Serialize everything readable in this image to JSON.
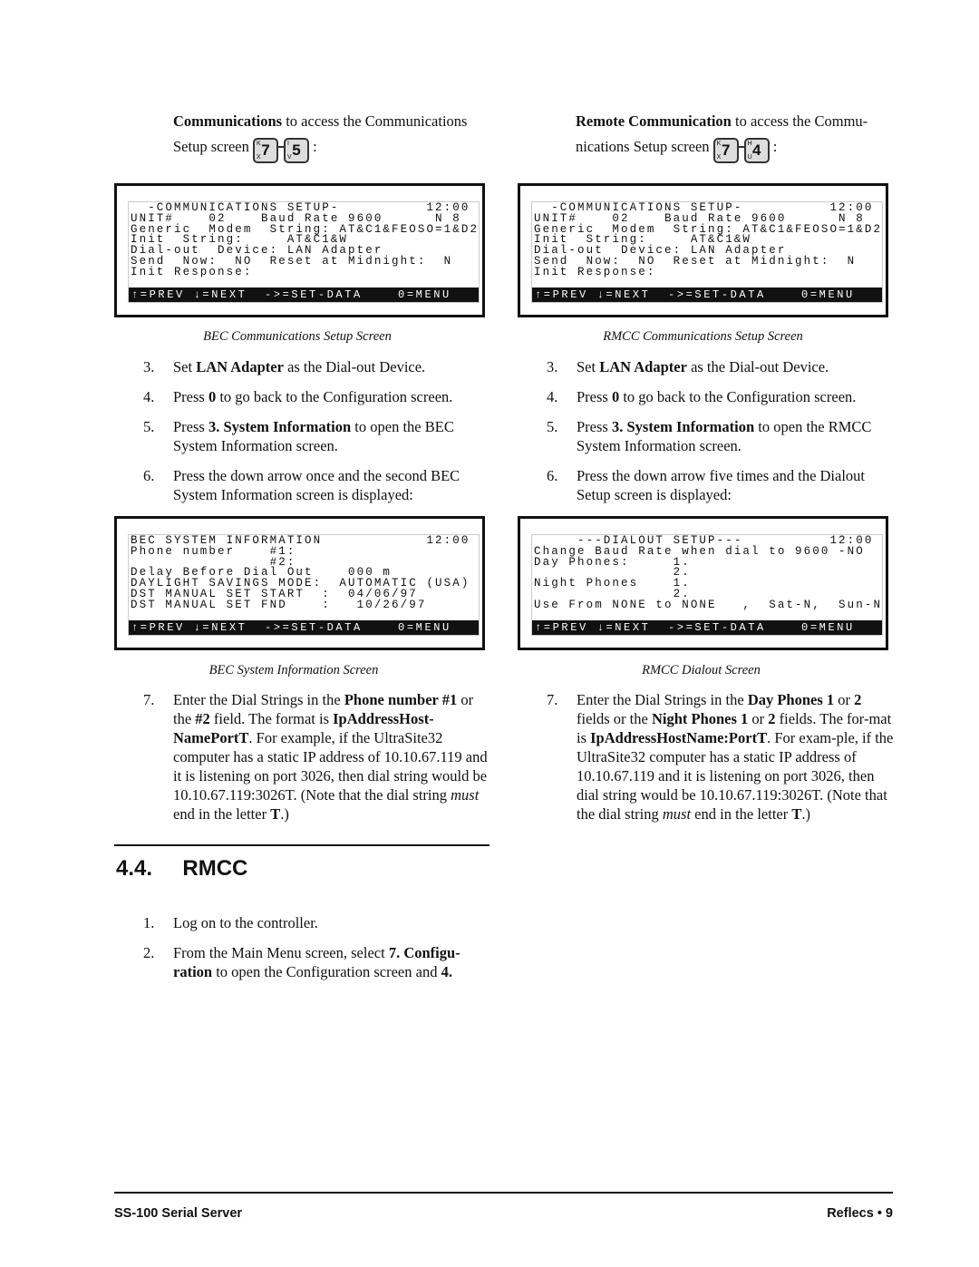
{
  "left": {
    "intro_bold": "Communications",
    "intro_rest": " to access the Communications",
    "intro_line2": "Setup screen",
    "keys": [
      {
        "main": "7",
        "top": "K",
        "bottom": "X"
      },
      {
        "main": "5",
        "top": "I",
        "bottom": "V"
      }
    ],
    "screen1": {
      "lines": "  -COMMUNICATIONS SETUP-          12:00\nUNIT#    02    Baud Rate 9600      N 8\nGeneric  Modem  String: AT&C1&FEOSO=1&D2\nInit  String:     AT&C1&W\nDial-out  Device: LAN Adapter\nSend  Now:  NO  Reset at Midnight:  N\nInit Response:",
      "bar": "↑=PREV ↓=NEXT  ->=SET-DATA    0=MENU"
    },
    "caption1": "BEC Communications Setup Screen",
    "steps": [
      {
        "n": "3.",
        "parts": [
          [
            "",
            "Set "
          ],
          [
            "b",
            "LAN Adapter"
          ],
          [
            "",
            "  as the Dial-out Device."
          ]
        ]
      },
      {
        "n": "4.",
        "parts": [
          [
            "",
            "Press "
          ],
          [
            "b",
            "0"
          ],
          [
            "",
            " to go back to the Configuration screen."
          ]
        ]
      },
      {
        "n": "5.",
        "parts": [
          [
            "",
            "Press "
          ],
          [
            "b",
            "3. System Information"
          ],
          [
            "",
            " to open the BEC System Information screen."
          ]
        ]
      },
      {
        "n": "6.",
        "parts": [
          [
            "",
            "Press the down arrow once and the second BEC System Information screen is displayed:"
          ]
        ]
      }
    ],
    "screen2": {
      "lines": "BEC SYSTEM INFORMATION            12:00\nPhone number    #1:\n                #2:\nDelay Before Dial Out    000 m\nDAYLIGHT SAVINGS MODE:  AUTOMATIC (USA)\nDST MANUAL SET START  :  04/06/97\nDST MANUAL SET FND    :   10/26/97",
      "bar": "↑=PREV ↓=NEXT  ->=SET-DATA    0=MENU"
    },
    "caption2": "BEC System Information Screen",
    "step7": {
      "n": "7.",
      "parts": [
        [
          "",
          "Enter the Dial Strings in the "
        ],
        [
          "b",
          "Phone number #1"
        ],
        [
          "",
          " or the "
        ],
        [
          "b",
          "#2"
        ],
        [
          "",
          " field. The format is "
        ],
        [
          "b",
          "IpAddressHost-NamePortT"
        ],
        [
          "",
          ". For example, if the UltraSite32 computer has a static IP address of 10.10.67.119 and it is listening on port 3026, then dial string would be 10.10.67.119:3026T. (Note that the dial string "
        ],
        [
          "i",
          "must"
        ],
        [
          "",
          " end in the letter "
        ],
        [
          "b",
          "T"
        ],
        [
          "",
          ".)"
        ]
      ]
    },
    "heading": "4.4.     RMCC",
    "rmcc_steps": [
      {
        "n": "1.",
        "parts": [
          [
            "",
            "Log on to the controller."
          ]
        ]
      },
      {
        "n": "2.",
        "parts": [
          [
            "",
            "From the Main Menu screen, select "
          ],
          [
            "b",
            "7. Configu-ration"
          ],
          [
            "",
            " to open the Configuration screen and "
          ],
          [
            "b",
            "4."
          ]
        ]
      }
    ]
  },
  "right": {
    "intro_bold": "Remote Communication",
    "intro_rest": " to access the Commu-",
    "intro_line2": "nications Setup screen",
    "keys": [
      {
        "main": "7",
        "top": "K",
        "bottom": "X"
      },
      {
        "main": "4",
        "top": "H",
        "bottom": "U"
      }
    ],
    "screen1": {
      "lines": "  -COMMUNICATIONS SETUP-          12:00\nUNIT#    02    Baud Rate 9600      N 8\nGeneric  Modem  String: AT&C1&FEOSO=1&D2\nInit  String:     AT&C1&W\nDial-out  Device: LAN Adapter\nSend  Now:  NO  Reset at Midnight:  N\nInit Response:",
      "bar": "↑=PREV ↓=NEXT  ->=SET-DATA    0=MENU"
    },
    "caption1": "RMCC Communications Setup Screen",
    "steps": [
      {
        "n": "3.",
        "parts": [
          [
            "",
            "Set "
          ],
          [
            "b",
            "LAN Adapter"
          ],
          [
            "",
            " as the Dial-out Device."
          ]
        ]
      },
      {
        "n": "4.",
        "parts": [
          [
            "",
            "Press "
          ],
          [
            "b",
            "0"
          ],
          [
            "",
            " to go back to the Configuration screen."
          ]
        ]
      },
      {
        "n": "5.",
        "parts": [
          [
            "",
            "Press "
          ],
          [
            "b",
            "3. System Information"
          ],
          [
            "",
            " to open the RMCC System Information screen."
          ]
        ]
      },
      {
        "n": "6.",
        "parts": [
          [
            "",
            "Press the down arrow five times and the Dialout Setup screen is displayed:"
          ]
        ]
      }
    ],
    "screen2": {
      "lines": "     ---DIALOUT SETUP---          12:00\nChange Baud Rate when dial to 9600 -NO\nDay Phones:     1.\n                2.\nNight Phones    1.\n                2.\nUse From NONE to NONE   ,  Sat-N,  Sun-N",
      "bar": "↑=PREV ↓=NEXT  ->=SET-DATA    0=MENU"
    },
    "caption2": "RMCC Dialout Screen",
    "step7": {
      "n": "7.",
      "parts": [
        [
          "",
          "Enter the Dial Strings in the "
        ],
        [
          "b",
          "Day Phones 1"
        ],
        [
          "",
          " or "
        ],
        [
          "b",
          "2"
        ],
        [
          "",
          " fields or the "
        ],
        [
          "b",
          "Night Phones 1"
        ],
        [
          "",
          " or "
        ],
        [
          "b",
          "2"
        ],
        [
          "",
          " fields. The for-mat is "
        ],
        [
          "b",
          "IpAddressHostName:PortT"
        ],
        [
          "",
          ". For exam-ple, if the UltraSite32 computer has a static IP address of 10.10.67.119 and it is listening on port 3026, then dial string would be 10.10.67.119:3026T. (Note that the dial string "
        ],
        [
          "i",
          "must"
        ],
        [
          "",
          " end in the letter "
        ],
        [
          "b",
          "T"
        ],
        [
          "",
          ".)"
        ]
      ]
    }
  },
  "footer": {
    "left": "SS-100 Serial Server",
    "right": "Reflecs • 9"
  }
}
